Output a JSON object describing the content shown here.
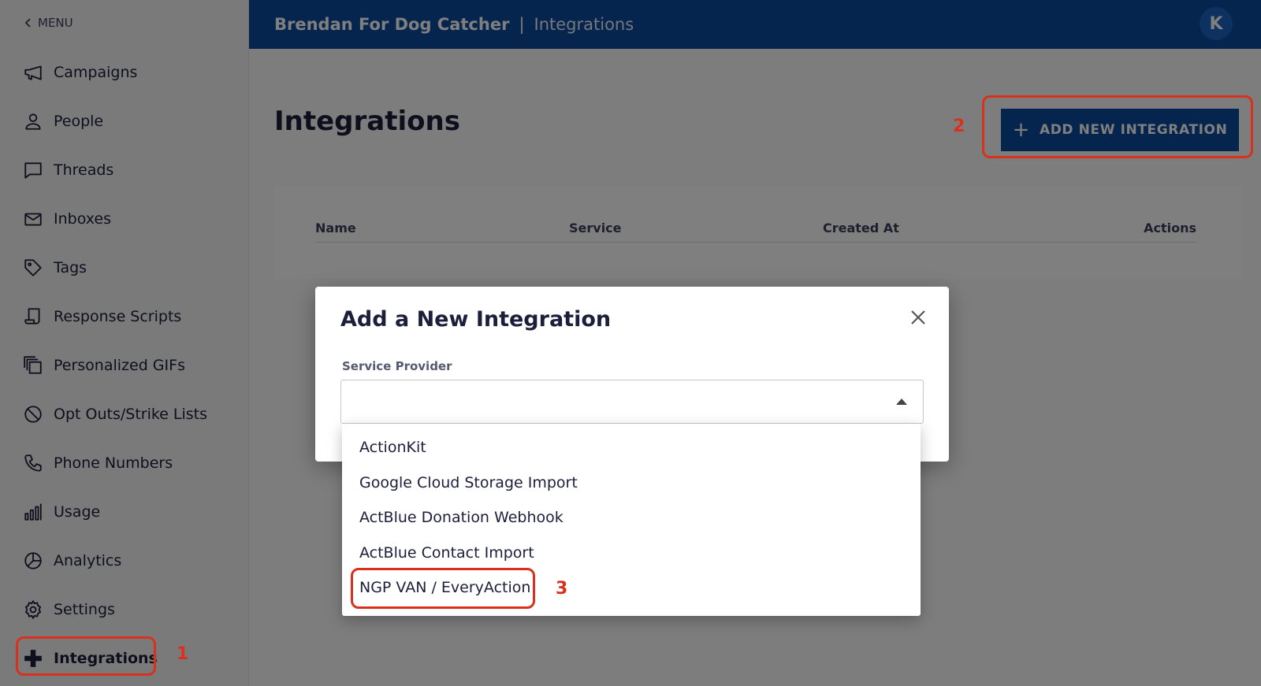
{
  "sidebar": {
    "menu_label": "MENU",
    "items": [
      {
        "label": "Campaigns",
        "icon": "megaphone-icon"
      },
      {
        "label": "People",
        "icon": "person-icon"
      },
      {
        "label": "Threads",
        "icon": "chat-bubble-icon"
      },
      {
        "label": "Inboxes",
        "icon": "envelope-icon"
      },
      {
        "label": "Tags",
        "icon": "tag-icon"
      },
      {
        "label": "Response Scripts",
        "icon": "script-icon"
      },
      {
        "label": "Personalized GIFs",
        "icon": "copy-stack-icon"
      },
      {
        "label": "Opt Outs/Strike Lists",
        "icon": "block-icon"
      },
      {
        "label": "Phone Numbers",
        "icon": "phone-icon"
      },
      {
        "label": "Usage",
        "icon": "bar-chart-icon"
      },
      {
        "label": "Analytics",
        "icon": "pie-chart-icon"
      },
      {
        "label": "Settings",
        "icon": "gear-icon"
      },
      {
        "label": "Integrations",
        "icon": "plus-icon",
        "active": true
      }
    ]
  },
  "header": {
    "org_name": "Brendan For Dog Catcher",
    "separator": "|",
    "page_name": "Integrations",
    "avatar_initial": "K"
  },
  "main": {
    "title": "Integrations",
    "add_button_label": "ADD NEW INTEGRATION",
    "table_headers": [
      "Name",
      "Service",
      "Created At",
      "Actions"
    ]
  },
  "modal": {
    "title": "Add a New Integration",
    "field_label": "Service Provider",
    "selected_value": "",
    "options": [
      "ActionKit",
      "Google Cloud Storage Import",
      "ActBlue Donation Webhook",
      "ActBlue Contact Import",
      "NGP VAN / EveryAction"
    ]
  },
  "annotations": [
    "1",
    "2",
    "3"
  ],
  "colors": {
    "primary": "#0b4b9c",
    "annotation": "#d9311d",
    "sidebar_bg": "#f4f4f4"
  }
}
